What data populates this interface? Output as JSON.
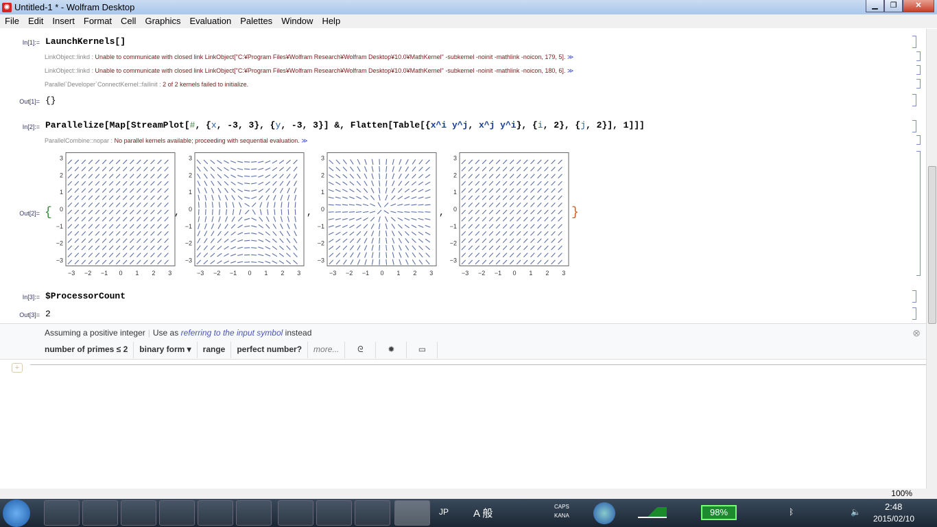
{
  "window": {
    "title": "Untitled-1 * - Wolfram Desktop",
    "minimize": "▁",
    "maximize": "❐",
    "close": "✕"
  },
  "menu": [
    "File",
    "Edit",
    "Insert",
    "Format",
    "Cell",
    "Graphics",
    "Evaluation",
    "Palettes",
    "Window",
    "Help"
  ],
  "cells": {
    "in1": {
      "label": "In[1]:=",
      "code": "LaunchKernels[]"
    },
    "msgs1": [
      {
        "tag": "LinkObject::linkd :",
        "text": " Unable to communicate with closed link LinkObject[\"C:¥Program Files¥Wolfram Research¥Wolfram Desktop¥10.0¥MathKernel\" -subkernel -noinit -mathlink -noicon, 179, 5]. ",
        "more": "≫"
      },
      {
        "tag": "LinkObject::linkd :",
        "text": " Unable to communicate with closed link LinkObject[\"C:¥Program Files¥Wolfram Research¥Wolfram Desktop¥10.0¥MathKernel\" -subkernel -noinit -mathlink -noicon, 180, 6]. ",
        "more": "≫"
      },
      {
        "tag": "Parallel`Developer`ConnectKernel::failinit :",
        "text": " 2 of 2 kernels failed to initialize.",
        "more": ""
      }
    ],
    "out1": {
      "label": "Out[1]=",
      "value": "{}"
    },
    "in2": {
      "label": "In[2]:=",
      "code_a": "Parallelize[Map[StreamPlot[",
      "hash": "#",
      "code_b": ", {",
      "x": "x",
      "code_c": ", -3, 3}, {",
      "y": "y",
      "code_d": ", -3, 3}] &, Flatten[Table[{",
      "e1": "x^i y^j",
      "code_e": ", ",
      "e2": "x^j y^i",
      "code_f": "}, {",
      "i": "i",
      "code_g": ", 2}, {",
      "j": "j",
      "code_h": ", 2}], 1]]]"
    },
    "msg2": {
      "tag": "ParallelCombine::nopar :",
      "text": " No parallel kernels available; proceeding with sequential evaluation. ",
      "more": "≫"
    },
    "out2": {
      "label": "Out[2]=",
      "open": "{",
      "close": "}",
      "sep": ","
    },
    "in3": {
      "label": "In[3]:=",
      "code": "$ProcessorCount"
    },
    "out3": {
      "label": "Out[3]=",
      "value": "2"
    }
  },
  "chart_data": [
    {
      "type": "streamplot",
      "field": "{x y, x y}",
      "xlim": [
        -3,
        3
      ],
      "ylim": [
        -3,
        3
      ],
      "ticks": [
        "-3",
        "-2",
        "-1",
        "0",
        "1",
        "2",
        "3"
      ],
      "color": "#5b6ea8"
    },
    {
      "type": "streamplot",
      "field": "{x y^2, x^2 y}",
      "xlim": [
        -3,
        3
      ],
      "ylim": [
        -3,
        3
      ],
      "ticks": [
        "-3",
        "-2",
        "-1",
        "0",
        "1",
        "2",
        "3"
      ],
      "color": "#5b6ea8"
    },
    {
      "type": "streamplot",
      "field": "{x^2 y, x y^2}",
      "xlim": [
        -3,
        3
      ],
      "ylim": [
        -3,
        3
      ],
      "ticks": [
        "-3",
        "-2",
        "-1",
        "0",
        "1",
        "2",
        "3"
      ],
      "color": "#5b6ea8"
    },
    {
      "type": "streamplot",
      "field": "{x^2 y^2, x^2 y^2}",
      "xlim": [
        -3,
        3
      ],
      "ylim": [
        -3,
        3
      ],
      "ticks": [
        "-3",
        "-2",
        "-1",
        "0",
        "1",
        "2",
        "3"
      ],
      "color": "#5b6ea8"
    }
  ],
  "assistant": {
    "assuming": "Assuming a positive integer",
    "use_as": "Use as",
    "alt": "referring to the input symbol",
    "instead": "instead",
    "buttons": [
      "number of primes ≤ 2",
      "binary form ▾",
      "range",
      "perfect number?"
    ],
    "more": "more...",
    "close": "⊗"
  },
  "status": {
    "zoom": "100%"
  },
  "taskbar": {
    "lang": "JP",
    "ime": "A 般",
    "caps": "CAPS",
    "kana": "KANA",
    "battery": "98%",
    "time": "2:48",
    "date": "2015/02/10"
  }
}
